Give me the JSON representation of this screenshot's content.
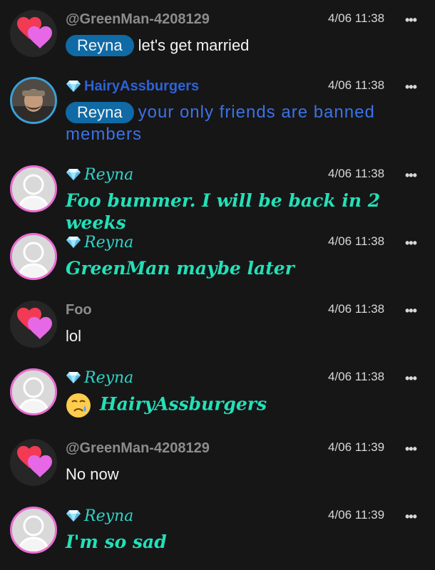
{
  "messages": [
    {
      "avatar": "hearts",
      "verified": false,
      "name": "@GreenMan-4208129",
      "name_style": "plain",
      "time": "4/06 11:38",
      "more": "•••",
      "mention": "Reyna",
      "text": "let's get married",
      "text_style": "plain",
      "emoji": null
    },
    {
      "avatar": "photo",
      "verified": true,
      "name": "HairyAssburgers",
      "name_style": "blue",
      "time": "4/06 11:38",
      "more": "•••",
      "mention": "Reyna",
      "text": "your only friends are banned members",
      "text_style": "blue",
      "emoji": null
    },
    {
      "avatar": "user",
      "verified": true,
      "name": "Reyna",
      "name_style": "script",
      "time": "4/06 11:38",
      "more": "•••",
      "mention": null,
      "text": "Foo bummer. I will be back in 2 weeks",
      "text_style": "script",
      "emoji": null
    },
    {
      "avatar": "user",
      "verified": true,
      "name": "Reyna",
      "name_style": "script",
      "time": "4/06 11:38",
      "more": "•••",
      "mention": null,
      "text": "GreenMan maybe later",
      "text_style": "script",
      "emoji": null
    },
    {
      "avatar": "hearts",
      "verified": false,
      "name": "Foo",
      "name_style": "plain",
      "time": "4/06 11:38",
      "more": "•••",
      "mention": null,
      "text": "lol",
      "text_style": "plain",
      "emoji": null
    },
    {
      "avatar": "user",
      "verified": true,
      "name": "Reyna",
      "name_style": "script",
      "time": "4/06 11:38",
      "more": "•••",
      "mention": null,
      "text": "HairyAssburgers",
      "text_style": "script",
      "emoji": "crying-face"
    },
    {
      "avatar": "hearts",
      "verified": false,
      "name": "@GreenMan-4208129",
      "name_style": "plain",
      "time": "4/06 11:39",
      "more": "•••",
      "mention": null,
      "text": "No now",
      "text_style": "plain",
      "emoji": null
    },
    {
      "avatar": "user",
      "verified": true,
      "name": "Reyna",
      "name_style": "script",
      "time": "4/06 11:39",
      "more": "•••",
      "mention": null,
      "text": "I'm so sad",
      "text_style": "script",
      "emoji": null
    }
  ],
  "colors": {
    "background": "#161616",
    "mention_bg": "#0f6aa5",
    "script_text": "#23e0b8",
    "blue_text": "#3b72e8",
    "user_avatar_ring": "#e96ed1"
  }
}
